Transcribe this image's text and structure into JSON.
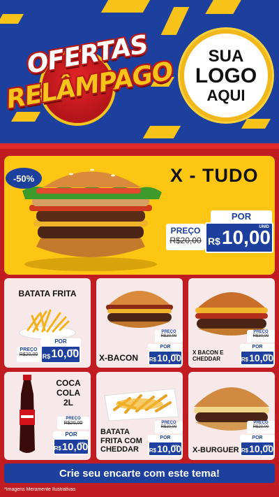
{
  "header": {
    "title_line1": "OFERTAS",
    "title_line2": "RELÂMPAGO",
    "logo_line1": "SUA",
    "logo_line2": "LOGO",
    "logo_line3": "AQUI"
  },
  "feature": {
    "discount": "-50%",
    "name": "X - TUDO",
    "por": "POR",
    "preco_label": "PREÇO",
    "old_price": "R$20,00",
    "currency": "R$",
    "price": "10,00",
    "unid": "UNID"
  },
  "cards": [
    {
      "name": "BATATA FRITA",
      "preco_label": "PREÇO",
      "old_price": "R$20,00",
      "por": "POR",
      "currency": "R$",
      "price": "10,00",
      "unid": "UNID"
    },
    {
      "name": "X-BACON",
      "preco_label": "PREÇO",
      "old_price": "R$20,00",
      "por": "POR",
      "currency": "R$",
      "price": "10,00",
      "unid": "UNID"
    },
    {
      "name": "X BACON E CHEDDAR",
      "preco_label": "PREÇO",
      "old_price": "R$20,00",
      "por": "POR",
      "currency": "R$",
      "price": "10,00",
      "unid": "UNID"
    },
    {
      "name": "COCA COLA 2L",
      "preco_label": "PREÇO",
      "old_price": "R$20,00",
      "por": "POR",
      "currency": "R$",
      "price": "10,00",
      "unid": "UNID"
    },
    {
      "name": "BATATA FRITA COM CHEDDAR",
      "preco_label": "PREÇO",
      "old_price": "R$20,00",
      "por": "POR",
      "currency": "R$",
      "price": "10,00",
      "unid": "UNID"
    },
    {
      "name": "X-BURGUER",
      "preco_label": "PREÇO",
      "old_price": "R$20,00",
      "por": "POR",
      "currency": "R$",
      "price": "10,00",
      "unid": "UNID"
    }
  ],
  "footer": {
    "cta": "Crie seu encarte com este tema!",
    "disclaimer": "*Imagens Meramente Ilustrativas"
  },
  "colors": {
    "blue": "#1d3f9e",
    "red": "#c01c21",
    "yellow": "#fcc612"
  }
}
